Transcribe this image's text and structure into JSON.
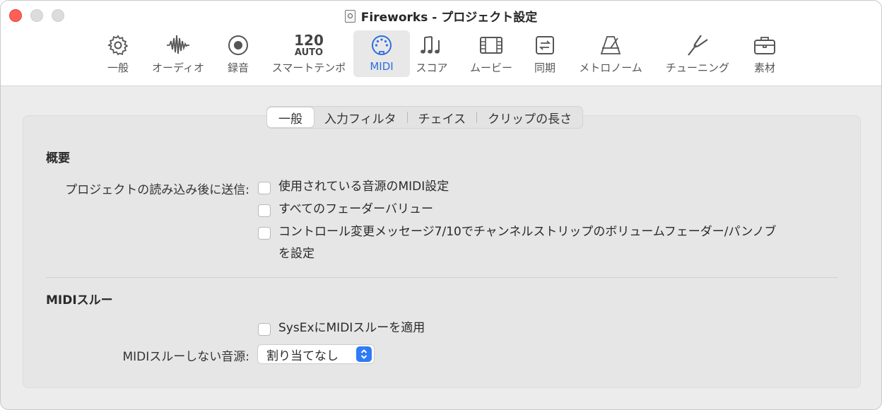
{
  "window": {
    "title": "Fireworks - プロジェクト設定"
  },
  "toolbar": {
    "items": [
      {
        "label": "一般",
        "icon": "gear-icon"
      },
      {
        "label": "オーディオ",
        "icon": "waveform-icon"
      },
      {
        "label": "録音",
        "icon": "record-icon"
      },
      {
        "label": "スマートテンポ",
        "icon": "tempo-icon",
        "tempo_value": "120",
        "tempo_mode": "AUTO"
      },
      {
        "label": "MIDI",
        "icon": "midi-port-icon",
        "selected": true
      },
      {
        "label": "スコア",
        "icon": "music-notes-icon"
      },
      {
        "label": "ムービー",
        "icon": "film-icon"
      },
      {
        "label": "同期",
        "icon": "sync-icon"
      },
      {
        "label": "メトロノーム",
        "icon": "metronome-icon"
      },
      {
        "label": "チューニング",
        "icon": "tuning-fork-icon"
      },
      {
        "label": "素材",
        "icon": "briefcase-icon"
      }
    ]
  },
  "tabs": [
    {
      "label": "一般",
      "active": true
    },
    {
      "label": "入力フィルタ"
    },
    {
      "label": "チェイス"
    },
    {
      "label": "クリップの長さ"
    }
  ],
  "overview": {
    "heading": "概要",
    "send_label": "プロジェクトの読み込み後に送信:",
    "options": [
      {
        "text": "使用されている音源のMIDI設定",
        "checked": false
      },
      {
        "text": "すべてのフェーダーバリュー",
        "checked": false
      },
      {
        "text": "コントロール変更メッセージ7/10でチャンネルストリップのボリュームフェーダー/パンノブ",
        "text2": "を設定",
        "checked": false
      }
    ]
  },
  "midi_thru": {
    "heading": "MIDIスルー",
    "sysex_option": {
      "text": "SysExにMIDIスルーを適用",
      "checked": false
    },
    "no_thru_label": "MIDIスルーしない音源:",
    "no_thru_value": "割り当てなし"
  },
  "colors": {
    "accent": "#2f7bf5",
    "close": "#fe5f57"
  }
}
